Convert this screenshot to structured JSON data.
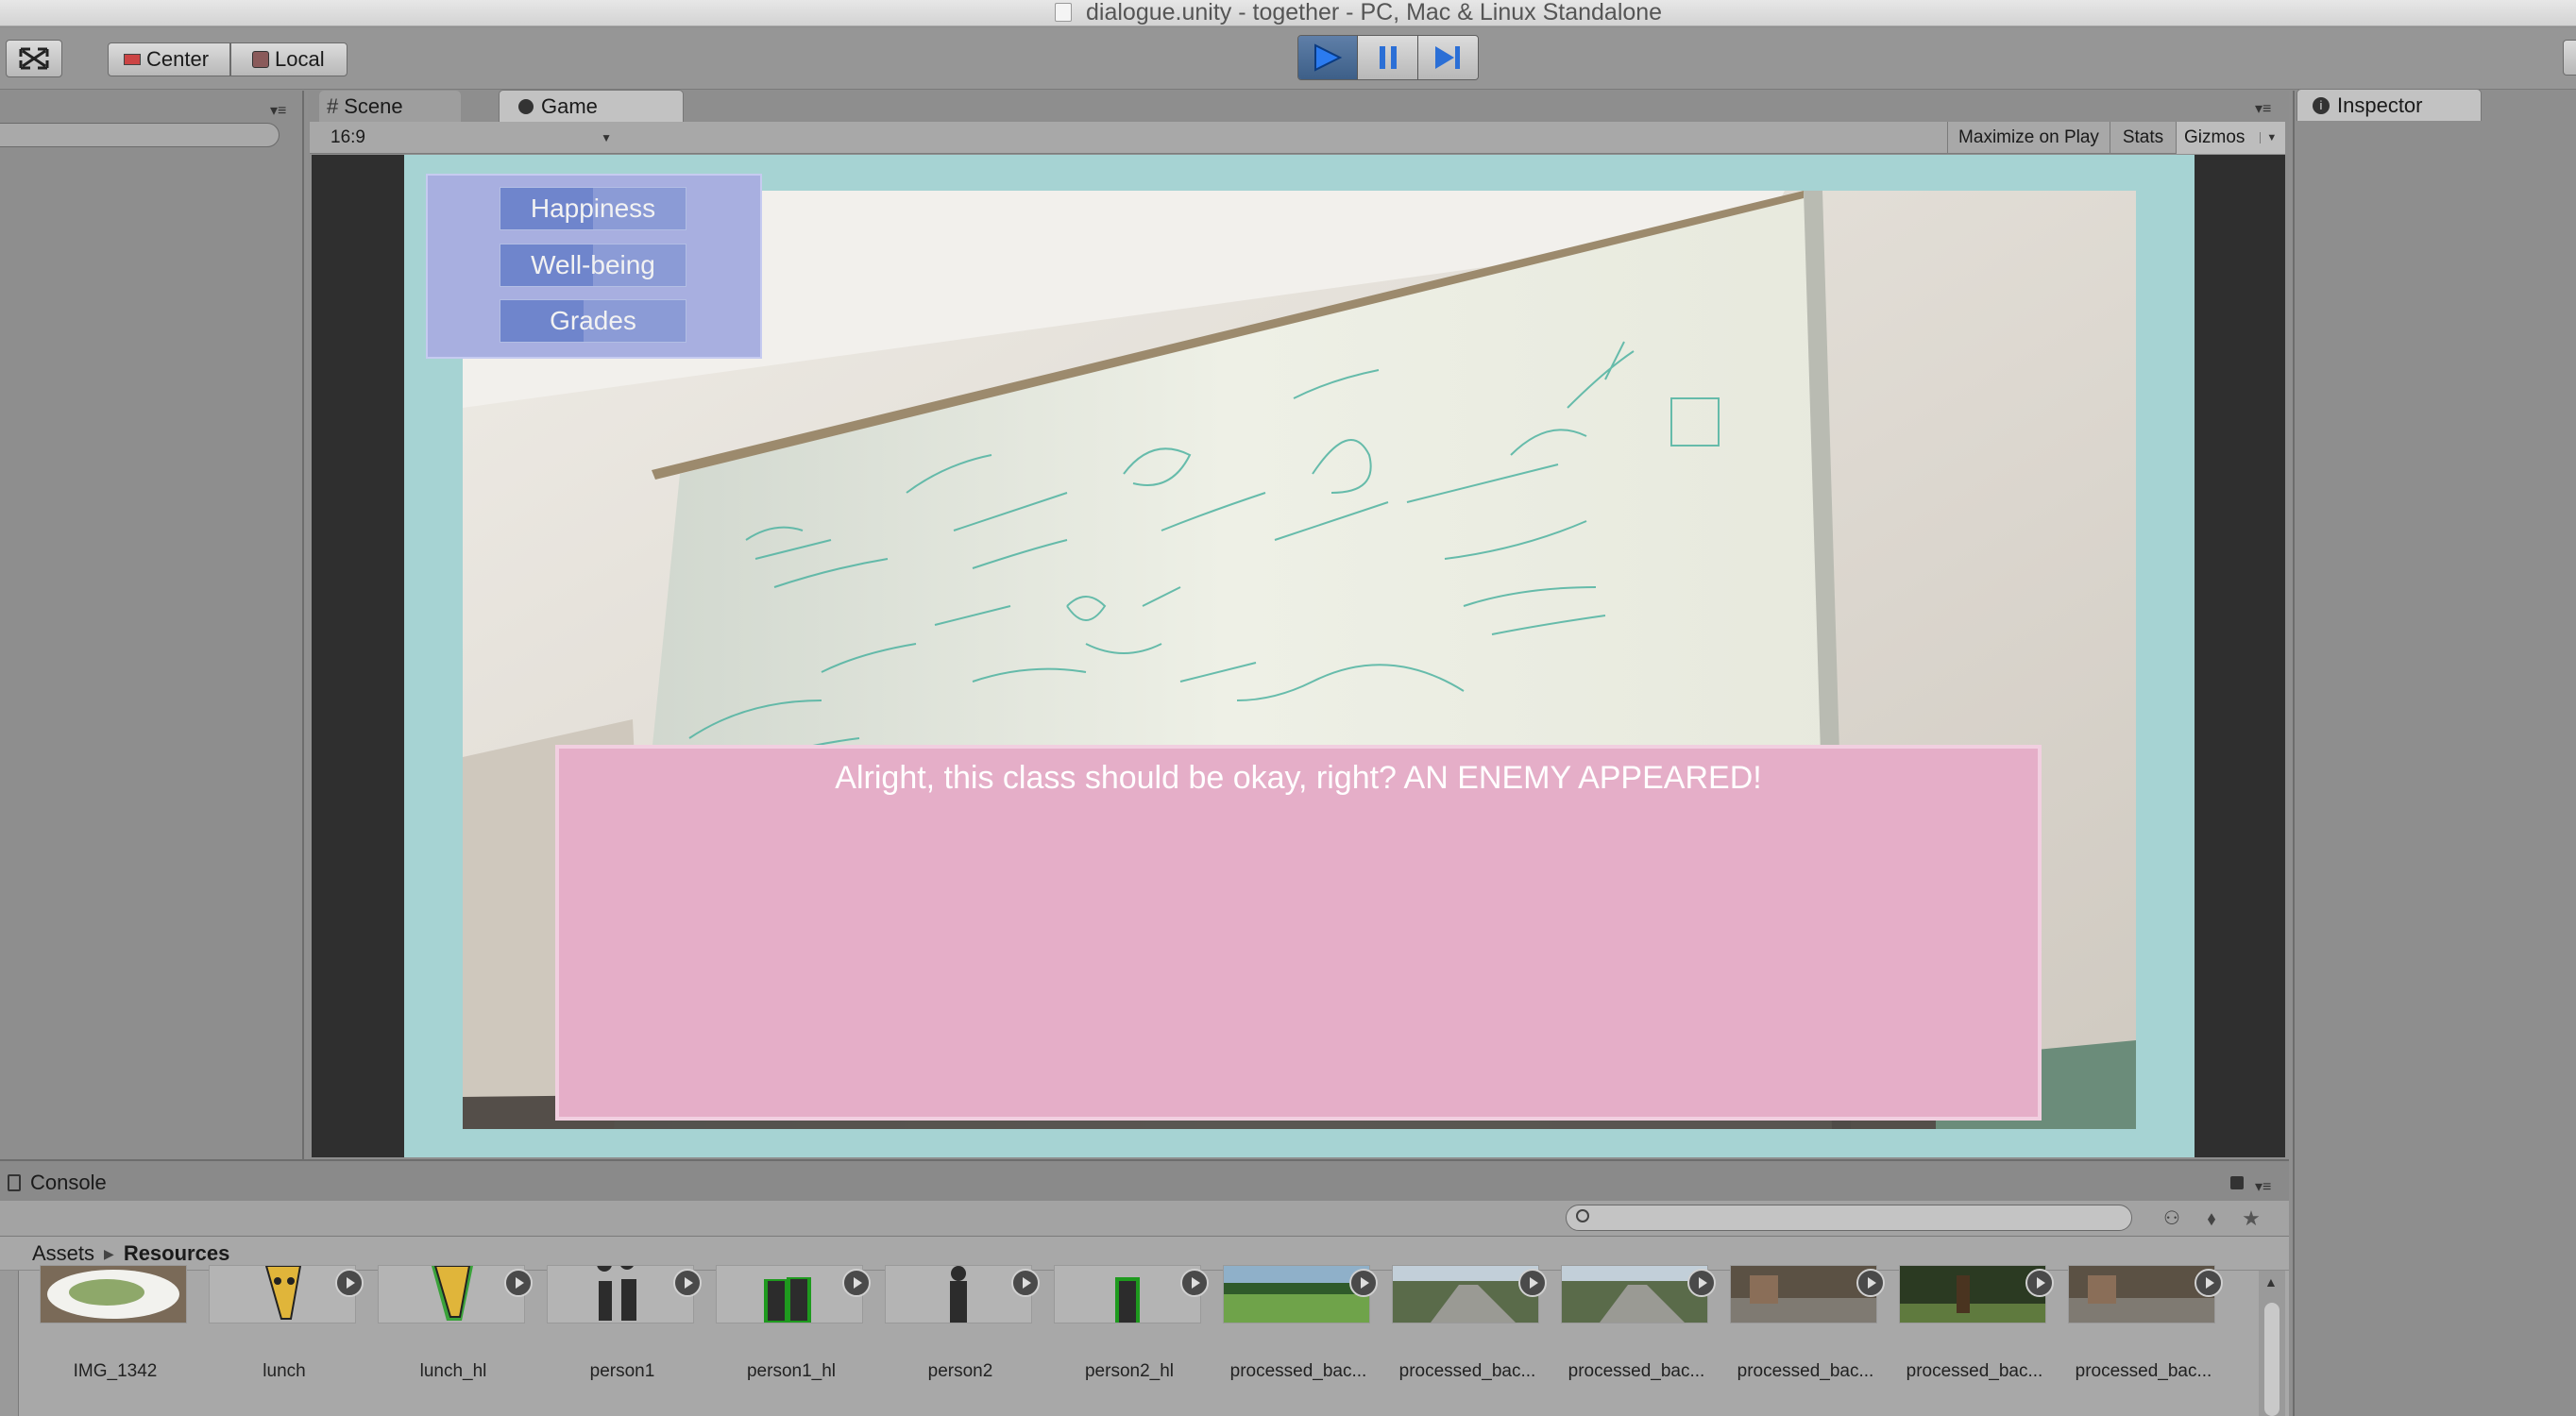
{
  "window": {
    "title": "dialogue.unity - together - PC, Mac & Linux Standalone"
  },
  "toolbar": {
    "pivot_label": "Center",
    "space_label": "Local",
    "play_icon": "play-icon",
    "pause_icon": "pause-icon",
    "step_icon": "step-icon"
  },
  "tabs": {
    "scene": "Scene",
    "game": "Game",
    "inspector": "Inspector",
    "console": "Console"
  },
  "game_view": {
    "aspect": "16:9",
    "maximize_label": "Maximize on Play",
    "stats_label": "Stats",
    "gizmos_label": "Gizmos",
    "stats": [
      {
        "label": "Happiness",
        "level": 0.5
      },
      {
        "label": "Well-being",
        "level": 0.5
      },
      {
        "label": "Grades",
        "level": 0.45
      }
    ],
    "dialogue_text": "Alright, this class should be okay, right? AN ENEMY APPEARED!"
  },
  "project": {
    "breadcrumb": [
      "Assets",
      "Resources"
    ],
    "assets": [
      {
        "label": "IMG_1342",
        "kind": "photo-food"
      },
      {
        "label": "lunch",
        "kind": "sprite-yellow"
      },
      {
        "label": "lunch_hl",
        "kind": "sprite-yellow-green"
      },
      {
        "label": "person1",
        "kind": "silhouette-dark"
      },
      {
        "label": "person1_hl",
        "kind": "silhouette-green"
      },
      {
        "label": "person2",
        "kind": "silhouette-single-dark"
      },
      {
        "label": "person2_hl",
        "kind": "silhouette-single-green"
      },
      {
        "label": "processed_bac...",
        "kind": "photo-grass"
      },
      {
        "label": "processed_bac...",
        "kind": "photo-path"
      },
      {
        "label": "processed_bac...",
        "kind": "photo-path"
      },
      {
        "label": "processed_bac...",
        "kind": "photo-street"
      },
      {
        "label": "processed_bac...",
        "kind": "photo-trees"
      },
      {
        "label": "processed_bac...",
        "kind": "photo-street"
      }
    ]
  },
  "colors": {
    "game_bg": "#a6d3d3",
    "dialogue_box": "#e5aec8",
    "stats_panel": "#a8afe0",
    "editor_grey": "#8f8f8f"
  }
}
